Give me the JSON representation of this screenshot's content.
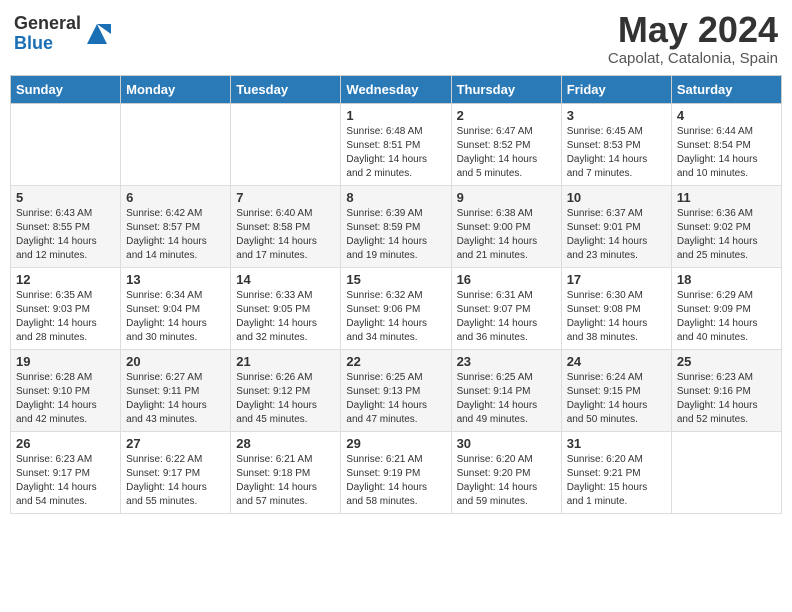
{
  "header": {
    "logo_general": "General",
    "logo_blue": "Blue",
    "month_title": "May 2024",
    "location": "Capolat, Catalonia, Spain"
  },
  "days_of_week": [
    "Sunday",
    "Monday",
    "Tuesday",
    "Wednesday",
    "Thursday",
    "Friday",
    "Saturday"
  ],
  "weeks": [
    [
      {
        "day": "",
        "sunrise": "",
        "sunset": "",
        "daylight": ""
      },
      {
        "day": "",
        "sunrise": "",
        "sunset": "",
        "daylight": ""
      },
      {
        "day": "",
        "sunrise": "",
        "sunset": "",
        "daylight": ""
      },
      {
        "day": "1",
        "sunrise": "Sunrise: 6:48 AM",
        "sunset": "Sunset: 8:51 PM",
        "daylight": "Daylight: 14 hours and 2 minutes."
      },
      {
        "day": "2",
        "sunrise": "Sunrise: 6:47 AM",
        "sunset": "Sunset: 8:52 PM",
        "daylight": "Daylight: 14 hours and 5 minutes."
      },
      {
        "day": "3",
        "sunrise": "Sunrise: 6:45 AM",
        "sunset": "Sunset: 8:53 PM",
        "daylight": "Daylight: 14 hours and 7 minutes."
      },
      {
        "day": "4",
        "sunrise": "Sunrise: 6:44 AM",
        "sunset": "Sunset: 8:54 PM",
        "daylight": "Daylight: 14 hours and 10 minutes."
      }
    ],
    [
      {
        "day": "5",
        "sunrise": "Sunrise: 6:43 AM",
        "sunset": "Sunset: 8:55 PM",
        "daylight": "Daylight: 14 hours and 12 minutes."
      },
      {
        "day": "6",
        "sunrise": "Sunrise: 6:42 AM",
        "sunset": "Sunset: 8:57 PM",
        "daylight": "Daylight: 14 hours and 14 minutes."
      },
      {
        "day": "7",
        "sunrise": "Sunrise: 6:40 AM",
        "sunset": "Sunset: 8:58 PM",
        "daylight": "Daylight: 14 hours and 17 minutes."
      },
      {
        "day": "8",
        "sunrise": "Sunrise: 6:39 AM",
        "sunset": "Sunset: 8:59 PM",
        "daylight": "Daylight: 14 hours and 19 minutes."
      },
      {
        "day": "9",
        "sunrise": "Sunrise: 6:38 AM",
        "sunset": "Sunset: 9:00 PM",
        "daylight": "Daylight: 14 hours and 21 minutes."
      },
      {
        "day": "10",
        "sunrise": "Sunrise: 6:37 AM",
        "sunset": "Sunset: 9:01 PM",
        "daylight": "Daylight: 14 hours and 23 minutes."
      },
      {
        "day": "11",
        "sunrise": "Sunrise: 6:36 AM",
        "sunset": "Sunset: 9:02 PM",
        "daylight": "Daylight: 14 hours and 25 minutes."
      }
    ],
    [
      {
        "day": "12",
        "sunrise": "Sunrise: 6:35 AM",
        "sunset": "Sunset: 9:03 PM",
        "daylight": "Daylight: 14 hours and 28 minutes."
      },
      {
        "day": "13",
        "sunrise": "Sunrise: 6:34 AM",
        "sunset": "Sunset: 9:04 PM",
        "daylight": "Daylight: 14 hours and 30 minutes."
      },
      {
        "day": "14",
        "sunrise": "Sunrise: 6:33 AM",
        "sunset": "Sunset: 9:05 PM",
        "daylight": "Daylight: 14 hours and 32 minutes."
      },
      {
        "day": "15",
        "sunrise": "Sunrise: 6:32 AM",
        "sunset": "Sunset: 9:06 PM",
        "daylight": "Daylight: 14 hours and 34 minutes."
      },
      {
        "day": "16",
        "sunrise": "Sunrise: 6:31 AM",
        "sunset": "Sunset: 9:07 PM",
        "daylight": "Daylight: 14 hours and 36 minutes."
      },
      {
        "day": "17",
        "sunrise": "Sunrise: 6:30 AM",
        "sunset": "Sunset: 9:08 PM",
        "daylight": "Daylight: 14 hours and 38 minutes."
      },
      {
        "day": "18",
        "sunrise": "Sunrise: 6:29 AM",
        "sunset": "Sunset: 9:09 PM",
        "daylight": "Daylight: 14 hours and 40 minutes."
      }
    ],
    [
      {
        "day": "19",
        "sunrise": "Sunrise: 6:28 AM",
        "sunset": "Sunset: 9:10 PM",
        "daylight": "Daylight: 14 hours and 42 minutes."
      },
      {
        "day": "20",
        "sunrise": "Sunrise: 6:27 AM",
        "sunset": "Sunset: 9:11 PM",
        "daylight": "Daylight: 14 hours and 43 minutes."
      },
      {
        "day": "21",
        "sunrise": "Sunrise: 6:26 AM",
        "sunset": "Sunset: 9:12 PM",
        "daylight": "Daylight: 14 hours and 45 minutes."
      },
      {
        "day": "22",
        "sunrise": "Sunrise: 6:25 AM",
        "sunset": "Sunset: 9:13 PM",
        "daylight": "Daylight: 14 hours and 47 minutes."
      },
      {
        "day": "23",
        "sunrise": "Sunrise: 6:25 AM",
        "sunset": "Sunset: 9:14 PM",
        "daylight": "Daylight: 14 hours and 49 minutes."
      },
      {
        "day": "24",
        "sunrise": "Sunrise: 6:24 AM",
        "sunset": "Sunset: 9:15 PM",
        "daylight": "Daylight: 14 hours and 50 minutes."
      },
      {
        "day": "25",
        "sunrise": "Sunrise: 6:23 AM",
        "sunset": "Sunset: 9:16 PM",
        "daylight": "Daylight: 14 hours and 52 minutes."
      }
    ],
    [
      {
        "day": "26",
        "sunrise": "Sunrise: 6:23 AM",
        "sunset": "Sunset: 9:17 PM",
        "daylight": "Daylight: 14 hours and 54 minutes."
      },
      {
        "day": "27",
        "sunrise": "Sunrise: 6:22 AM",
        "sunset": "Sunset: 9:17 PM",
        "daylight": "Daylight: 14 hours and 55 minutes."
      },
      {
        "day": "28",
        "sunrise": "Sunrise: 6:21 AM",
        "sunset": "Sunset: 9:18 PM",
        "daylight": "Daylight: 14 hours and 57 minutes."
      },
      {
        "day": "29",
        "sunrise": "Sunrise: 6:21 AM",
        "sunset": "Sunset: 9:19 PM",
        "daylight": "Daylight: 14 hours and 58 minutes."
      },
      {
        "day": "30",
        "sunrise": "Sunrise: 6:20 AM",
        "sunset": "Sunset: 9:20 PM",
        "daylight": "Daylight: 14 hours and 59 minutes."
      },
      {
        "day": "31",
        "sunrise": "Sunrise: 6:20 AM",
        "sunset": "Sunset: 9:21 PM",
        "daylight": "Daylight: 15 hours and 1 minute."
      },
      {
        "day": "",
        "sunrise": "",
        "sunset": "",
        "daylight": ""
      }
    ]
  ]
}
